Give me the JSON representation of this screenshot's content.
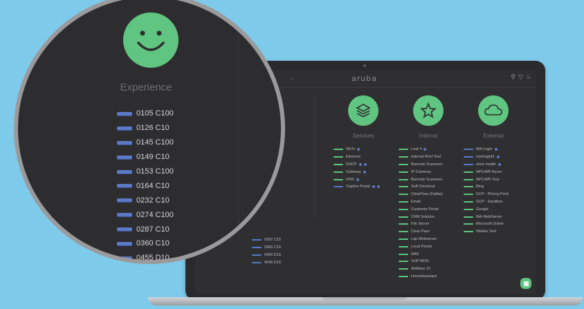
{
  "app": {
    "brand": "aruba"
  },
  "experience": {
    "title": "Experience",
    "devices": [
      "0105 C100",
      "0126 C10",
      "0145 C100",
      "0149 C10",
      "0153 C100",
      "0164 C10",
      "0232 C10",
      "0274 C100",
      "0287 C10",
      "0360 C10",
      "0455 D10"
    ]
  },
  "experience_peek": [
    "0287 C10",
    "0360 C10",
    "0455 D10",
    "0645 D10"
  ],
  "columns": [
    {
      "title": "Services",
      "icon": "layers-icon",
      "items": [
        {
          "label": "Wi-Fi",
          "bar": "green",
          "badges": 1
        },
        {
          "label": "Ethernet",
          "bar": "green",
          "badges": 0
        },
        {
          "label": "DHCP",
          "bar": "green",
          "badges": 2
        },
        {
          "label": "Gateway",
          "bar": "green",
          "badges": 1
        },
        {
          "label": "DNS",
          "bar": "green",
          "badges": 1
        },
        {
          "label": "Captive Portal",
          "bar": "blue",
          "badges": 2
        }
      ]
    },
    {
      "title": "Internal",
      "icon": "star-icon",
      "items": [
        {
          "label": "Leaf 4",
          "bar": "green",
          "badges": 1
        },
        {
          "label": "Internal IPerf Test",
          "bar": "green",
          "badges": 0
        },
        {
          "label": "Barcode Scanners",
          "bar": "green",
          "badges": 0
        },
        {
          "label": "IP Cameras",
          "bar": "green",
          "badges": 0
        },
        {
          "label": "Barcode Scanners",
          "bar": "green",
          "badges": 0
        },
        {
          "label": "Self Checkout",
          "bar": "green",
          "badges": 0
        },
        {
          "label": "ClearPass (Dallas)",
          "bar": "green",
          "badges": 0
        },
        {
          "label": "Email",
          "bar": "green",
          "badges": 0
        },
        {
          "label": "Customer Portal",
          "bar": "green",
          "badges": 0
        },
        {
          "label": "CRM Solution",
          "bar": "green",
          "badges": 0
        },
        {
          "label": "File Server",
          "bar": "green",
          "badges": 0
        },
        {
          "label": "Clear Pass",
          "bar": "green",
          "badges": 0
        },
        {
          "label": "Lap Webserver",
          "bar": "green",
          "badges": 0
        },
        {
          "label": "Local Printer",
          "bar": "green",
          "badges": 0
        },
        {
          "label": "NAS",
          "bar": "green",
          "badges": 0
        },
        {
          "label": "VoIP MOS",
          "bar": "green",
          "badges": 0
        },
        {
          "label": "AirWave 10",
          "bar": "green",
          "badges": 0
        },
        {
          "label": "HomeAssistant",
          "bar": "green",
          "badges": 0
        }
      ]
    },
    {
      "title": "External",
      "icon": "cloud-icon",
      "items": [
        {
          "label": "MA-Login",
          "bar": "blue",
          "badges": 1
        },
        {
          "label": "myInsight2",
          "bar": "blue",
          "badges": 1
        },
        {
          "label": "store health",
          "bar": "blue",
          "badges": 1
        },
        {
          "label": "APC/API Azure",
          "bar": "green",
          "badges": 0
        },
        {
          "label": "APC/API Test",
          "bar": "green",
          "badges": 0
        },
        {
          "label": "Bing",
          "bar": "green",
          "badges": 0
        },
        {
          "label": "GCP - Pricing Prod",
          "bar": "green",
          "badges": 0
        },
        {
          "label": "GCP - Sandbox",
          "bar": "green",
          "badges": 0
        },
        {
          "label": "Google",
          "bar": "green",
          "badges": 0
        },
        {
          "label": "MA-WebServer",
          "bar": "green",
          "badges": 0
        },
        {
          "label": "Microsoft Online",
          "bar": "green",
          "badges": 0
        },
        {
          "label": "WebEx Test",
          "bar": "green",
          "badges": 0
        }
      ]
    }
  ],
  "colors": {
    "background": "#7ecaeb",
    "good": "#5fc581",
    "degraded": "#5b79c6",
    "screen": "#2f2f31"
  }
}
